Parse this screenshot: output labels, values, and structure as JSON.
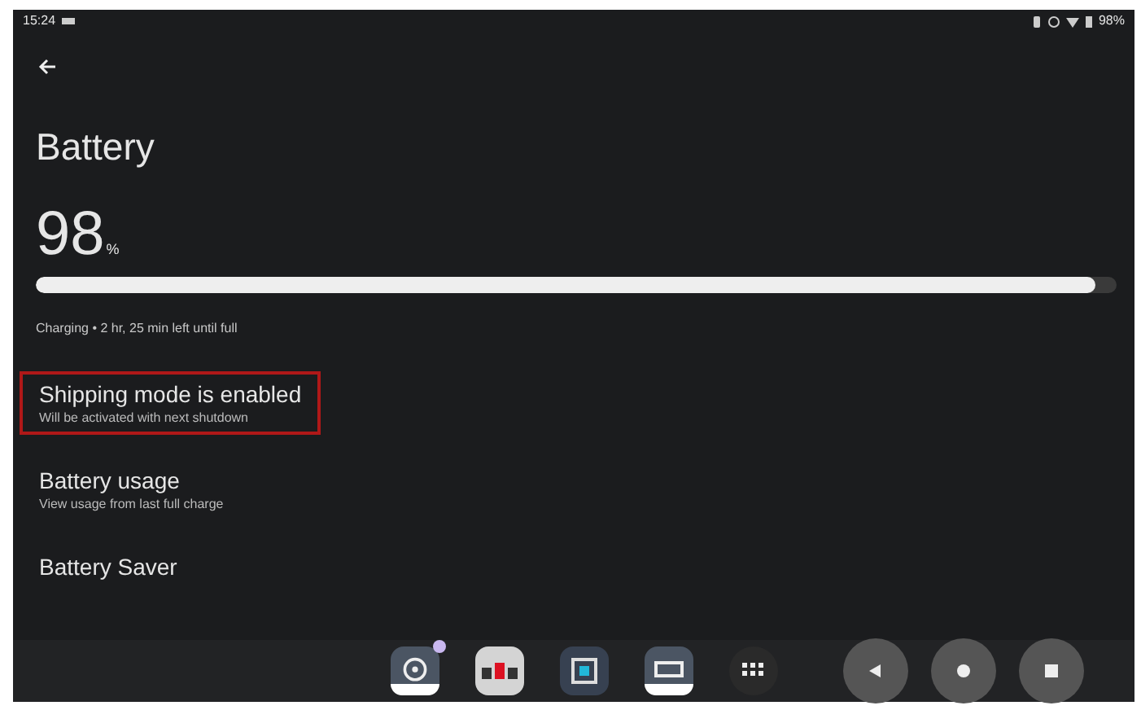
{
  "status_bar": {
    "time": "15:24",
    "battery": "98%"
  },
  "title": "Battery",
  "battery": {
    "percent": "98",
    "unit": "%",
    "level": 0.98,
    "status": "Charging • 2 hr, 25 min left until full"
  },
  "items": [
    {
      "title": "Shipping mode is enabled",
      "summary": "Will be activated with next shutdown",
      "highlighted": true
    },
    {
      "title": "Battery usage",
      "summary": "View usage from last full charge",
      "highlighted": false
    },
    {
      "title": "Battery Saver",
      "highlighted": false
    }
  ],
  "taskbar": {
    "apps": [
      {
        "kind": "wheel",
        "badge": true
      },
      {
        "kind": "cars",
        "badge": false
      },
      {
        "kind": "square",
        "badge": false
      },
      {
        "kind": "tool",
        "badge": false
      },
      {
        "kind": "drawer",
        "badge": false
      }
    ],
    "nav": [
      {
        "kind": "back"
      },
      {
        "kind": "home"
      },
      {
        "kind": "recents"
      }
    ]
  }
}
